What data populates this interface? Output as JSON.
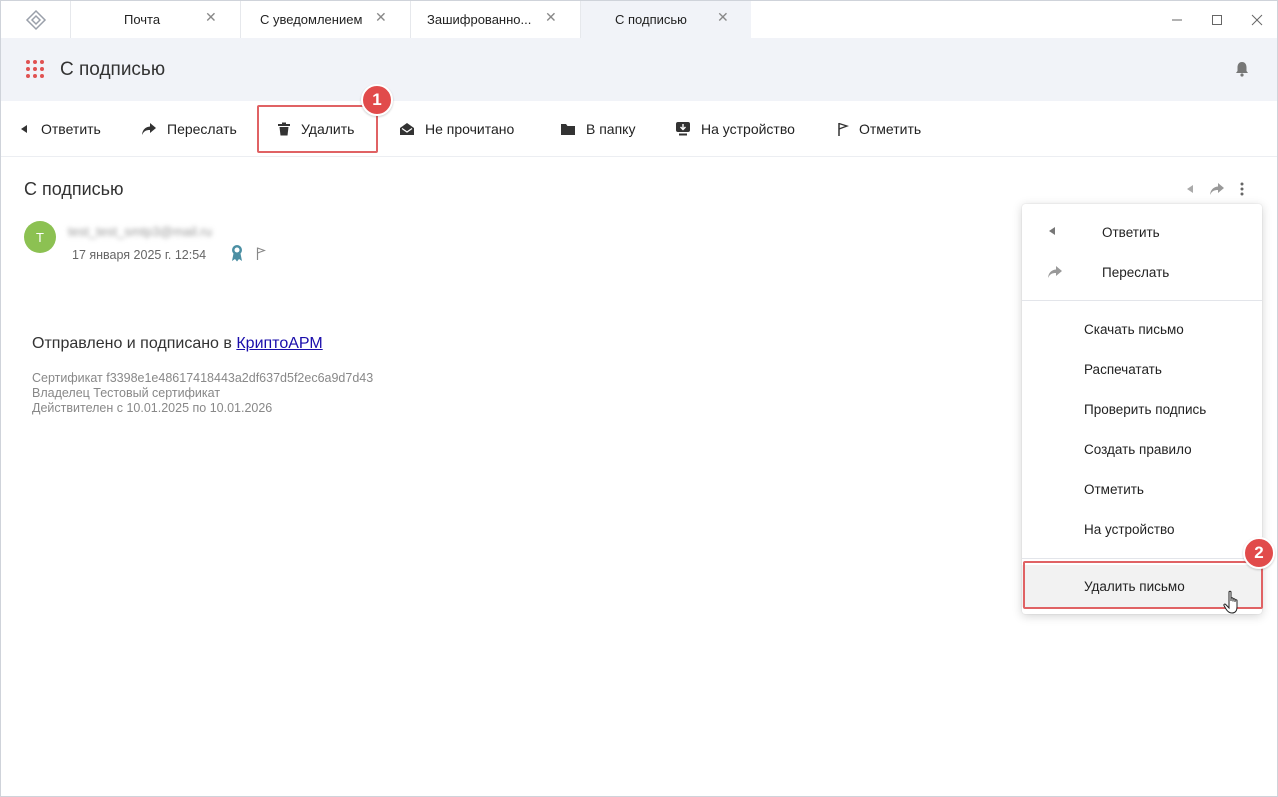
{
  "tabs": [
    {
      "label": "Почта",
      "active": false
    },
    {
      "label": "С уведомлением",
      "active": false
    },
    {
      "label": "Зашифрованно...",
      "active": false
    },
    {
      "label": "С подписью",
      "active": true
    }
  ],
  "window_controls": {
    "minimize": "—",
    "maximize": "☐",
    "close": "✕"
  },
  "header": {
    "title": "С подписью",
    "accent_color": "#e05252"
  },
  "toolbar": {
    "reply": "Ответить",
    "forward": "Переслать",
    "delete": "Удалить",
    "unread": "Не прочитано",
    "to_folder": "В папку",
    "to_device": "На устройство",
    "mark": "Отметить"
  },
  "annotations": {
    "badge1": "1",
    "badge2": "2",
    "highlight_color": "#e06264"
  },
  "message": {
    "subject": "С подписью",
    "avatar_letter": "T",
    "sender": "test_test_smtp3@mail.ru",
    "date": "17 января 2025 г. 12:54",
    "body_prefix": "Отправлено и подписано в ",
    "body_link": "КриптоАРМ",
    "cert_line1": "Сертификат f3398e1e48617418443a2df637d5f2ec6a9d7d43",
    "cert_line2": "Владелец Тестовый сертификат",
    "cert_line3": "Действителен с 10.01.2025 по 10.01.2026"
  },
  "menu": {
    "reply": "Ответить",
    "forward": "Переслать",
    "download": "Скачать письмо",
    "print": "Распечатать",
    "verify": "Проверить подпись",
    "create_rule": "Создать правило",
    "mark": "Отметить",
    "to_device": "На устройство",
    "delete": "Удалить письмо"
  }
}
